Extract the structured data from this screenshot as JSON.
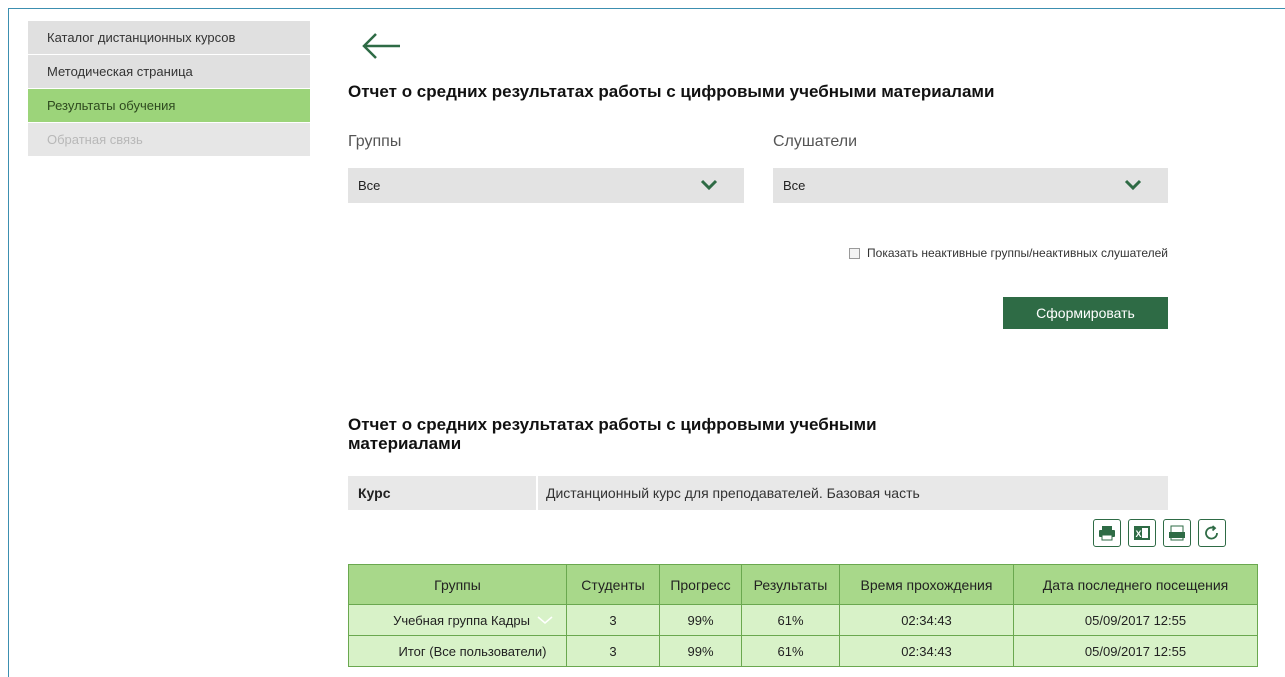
{
  "sidebar": {
    "items": [
      {
        "label": "Каталог дистанционных курсов"
      },
      {
        "label": "Методическая страница"
      },
      {
        "label": "Результаты обучения"
      },
      {
        "label": "Обратная связь"
      }
    ]
  },
  "page": {
    "title": "Отчет о средних результатах работы с цифровыми учебными материалами"
  },
  "filters": {
    "groups_label": "Группы",
    "groups_value": "Все",
    "listeners_label": "Слушатели",
    "listeners_value": "Все",
    "inactive_checkbox_label": "Показать неактивные группы/неактивных слушателей",
    "submit_label": "Сформировать"
  },
  "report": {
    "title": "Отчет о средних результатах работы с цифровыми учебными материалами",
    "course_key": "Курс",
    "course_value": "Дистанционный курс для преподавателей. Базовая часть",
    "columns": [
      "Группы",
      "Студенты",
      "Прогресс",
      "Результаты",
      "Время прохождения",
      "Дата последнего посещения"
    ],
    "rows": [
      [
        "Учебная группа Кадры",
        "3",
        "99%",
        "61%",
        "02:34:43",
        "05/09/2017 12:55"
      ],
      [
        "Итог (Все пользователи)",
        "3",
        "99%",
        "61%",
        "02:34:43",
        "05/09/2017 12:55"
      ]
    ]
  },
  "toolbar": {
    "icons": [
      "print-icon",
      "excel-icon",
      "pdf-icon",
      "refresh-icon"
    ]
  },
  "colors": {
    "accent_green": "#2e6b45",
    "active_menu": "#9cd47a",
    "table_header": "#a8d88a",
    "table_row": "#d8f2c8"
  }
}
